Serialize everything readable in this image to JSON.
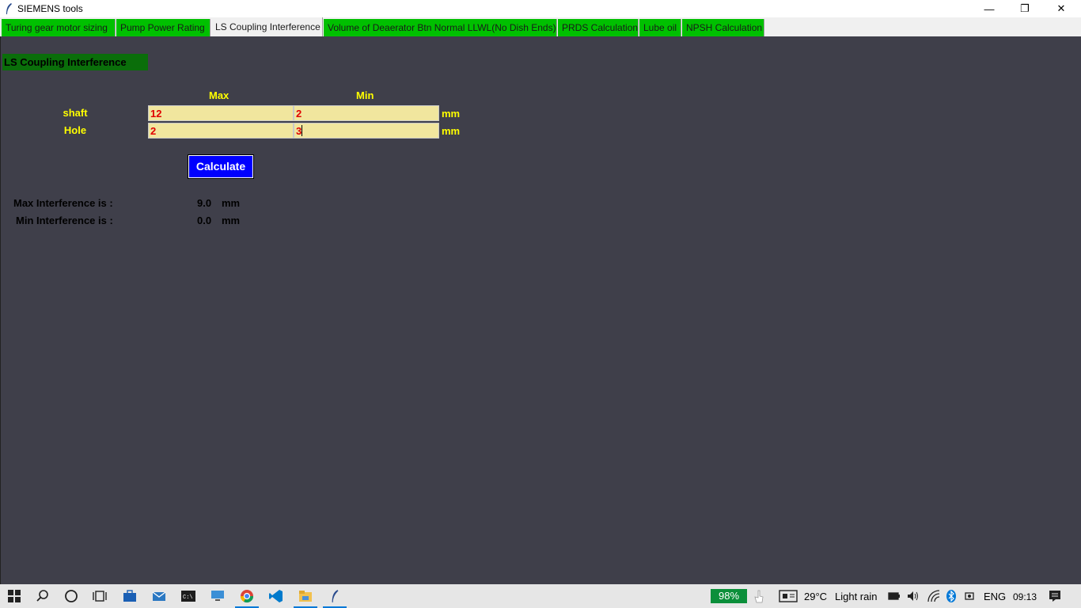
{
  "window": {
    "title": "SIEMENS tools",
    "minimize_glyph": "—",
    "maximize_glyph": "❐",
    "close_glyph": "✕"
  },
  "tabs": [
    {
      "label": "Turing gear motor sizing",
      "active": false
    },
    {
      "label": "Pump Power Rating",
      "active": false
    },
    {
      "label": "LS Coupling Interference",
      "active": true
    },
    {
      "label": "Volume of Deaerator Btn Normal LLWL(No Dish Ends)",
      "active": false
    },
    {
      "label": "PRDS Calculation",
      "active": false
    },
    {
      "label": "Lube oil",
      "active": false
    },
    {
      "label": "NPSH Calculation",
      "active": false
    }
  ],
  "form": {
    "section_title": "LS Coupling Interference",
    "col_max": "Max",
    "col_min": "Min",
    "shaft_label": "shaft",
    "hole_label": "Hole",
    "shaft_max": "12",
    "shaft_min": "2",
    "hole_max": "2",
    "hole_min": "3",
    "unit": "mm",
    "calculate_label": "Calculate"
  },
  "results": {
    "max_label": "Max Interference is :",
    "max_value": "9.0",
    "min_label": "Min Interference is :",
    "min_value": "0.0",
    "unit": "mm"
  },
  "taskbar": {
    "battery": "98%",
    "temperature": "29°C",
    "weather": "Light rain",
    "language": "ENG",
    "time": "09:13"
  },
  "colors": {
    "background": "#3f3f4a",
    "tab_green": "#00c000",
    "label_yellow": "#ffff00",
    "field_bg": "#f1e69e",
    "field_text": "#e00000",
    "button_blue": "#0000ff"
  }
}
